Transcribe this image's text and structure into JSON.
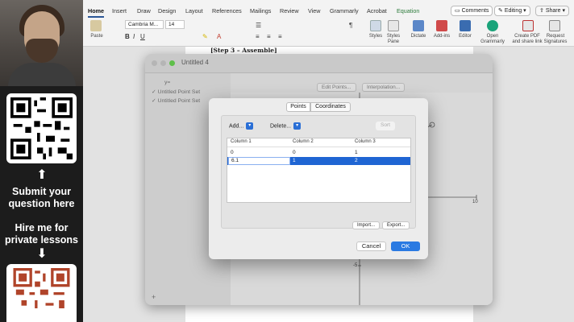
{
  "sidebar": {
    "submit_text": "Submit your question here",
    "hire_text": "Hire me for private lessons"
  },
  "word": {
    "tabs": [
      "Home",
      "Insert",
      "Draw",
      "Design",
      "Layout",
      "References",
      "Mailings",
      "Review",
      "View",
      "Grammarly",
      "Acrobat",
      "Equation"
    ],
    "comments_label": "Comments",
    "editing_label": "Editing",
    "share_label": "Share",
    "paste_label": "Paste",
    "font_name": "Cambria M...",
    "font_size": "14",
    "ribbon_groups": [
      "Styles",
      "Styles Pane",
      "Dictate",
      "Add-ins",
      "Editor",
      "Open Grammarly",
      "Create PDF and share link",
      "Request Signatures"
    ],
    "page_text": "[Step 3 – Assemble]"
  },
  "graph_app": {
    "title": "Untitled 4",
    "sidebar_items": [
      "y=",
      "Untitled Point Set",
      "Untitled Point Set"
    ],
    "edit_points_label": "Edit Points...",
    "interpolation_label": "Interpolation...",
    "axis_label_10": "10",
    "axis_label_neg5": "-5"
  },
  "dialog": {
    "tabs": [
      "Points",
      "Coordinates"
    ],
    "add_label": "Add...",
    "delete_label": "Delete...",
    "sort_label": "Sort",
    "columns": [
      "Column 1",
      "Column 2",
      "Column 3"
    ],
    "rows": [
      [
        "0",
        "0",
        "1"
      ],
      [
        "6.1",
        "1",
        "2"
      ]
    ],
    "import_label": "Import...",
    "export_label": "Export...",
    "cancel_label": "Cancel",
    "ok_label": "OK"
  }
}
